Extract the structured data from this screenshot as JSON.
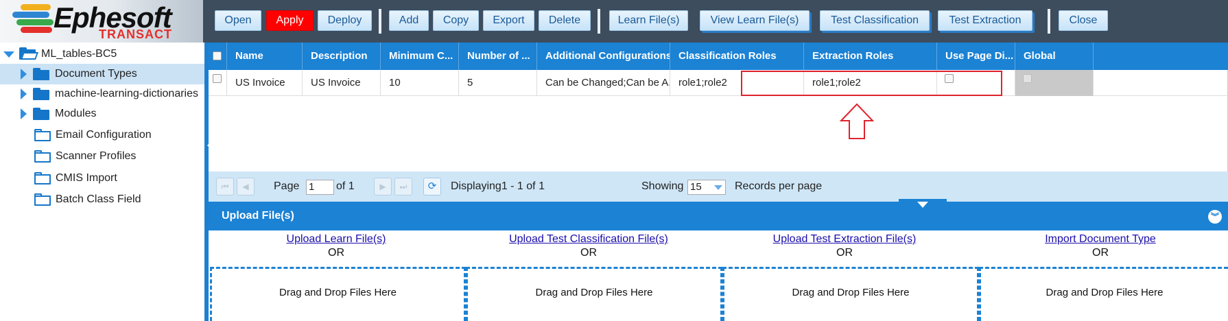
{
  "logo": {
    "name": "Ephesoft",
    "subtitle": "TRANSACT"
  },
  "toolbar": {
    "open": "Open",
    "apply": "Apply",
    "deploy": "Deploy",
    "add": "Add",
    "copy": "Copy",
    "export": "Export",
    "delete": "Delete",
    "learn_files": "Learn File(s)",
    "view_learn_files": "View Learn File(s)",
    "test_classification": "Test Classification",
    "test_extraction": "Test Extraction",
    "close": "Close"
  },
  "tree": {
    "root": "ML_tables-BC5",
    "items": [
      {
        "label": "Document Types",
        "icon": "folder-filled-icon"
      },
      {
        "label": "machine-learning-dictionaries",
        "icon": "folder-filled-icon"
      },
      {
        "label": "Modules",
        "icon": "folder-filled-icon"
      },
      {
        "label": "Email Configuration",
        "icon": "folder-outline-icon"
      },
      {
        "label": "Scanner Profiles",
        "icon": "folder-outline-icon"
      },
      {
        "label": "CMIS Import",
        "icon": "folder-outline-icon"
      },
      {
        "label": "Batch Class Field",
        "icon": "folder-outline-icon"
      }
    ]
  },
  "grid": {
    "columns": [
      "Name",
      "Description",
      "Minimum C...",
      "Number of ...",
      "Additional Configurations",
      "Classification Roles",
      "Extraction Roles",
      "Use Page Di...",
      "Global"
    ],
    "rows": [
      {
        "name": "US Invoice",
        "description": "US Invoice",
        "minimum": "10",
        "number": "5",
        "additional": "Can be Changed;Can be A...",
        "classification_roles": "role1;role2",
        "extraction_roles": "role1;role2",
        "use_page": false,
        "global": false
      }
    ]
  },
  "pager": {
    "page_label": "Page",
    "page_value": "1",
    "of_label": "of 1",
    "displaying": "Displaying1 - 1 of 1",
    "showing_label": "Showing",
    "per_page_value": "15",
    "records_label": "Records per page"
  },
  "upload": {
    "title": "Upload File(s)",
    "columns": [
      {
        "link": "Upload Learn File(s)",
        "or": "OR",
        "drop": "Drag and Drop Files Here"
      },
      {
        "link": "Upload Test Classification File(s)",
        "or": "OR",
        "drop": "Drag and Drop Files Here"
      },
      {
        "link": "Upload Test Extraction File(s)",
        "or": "OR",
        "drop": "Drag and Drop Files Here"
      },
      {
        "link": "Import Document Type",
        "or": "OR",
        "drop": "Drag and Drop Files Here"
      }
    ]
  },
  "colors": {
    "accent": "#1b82d4",
    "apply": "#ff0000",
    "highlight": "#e0232e",
    "toolbar": "#3d4d5e"
  }
}
